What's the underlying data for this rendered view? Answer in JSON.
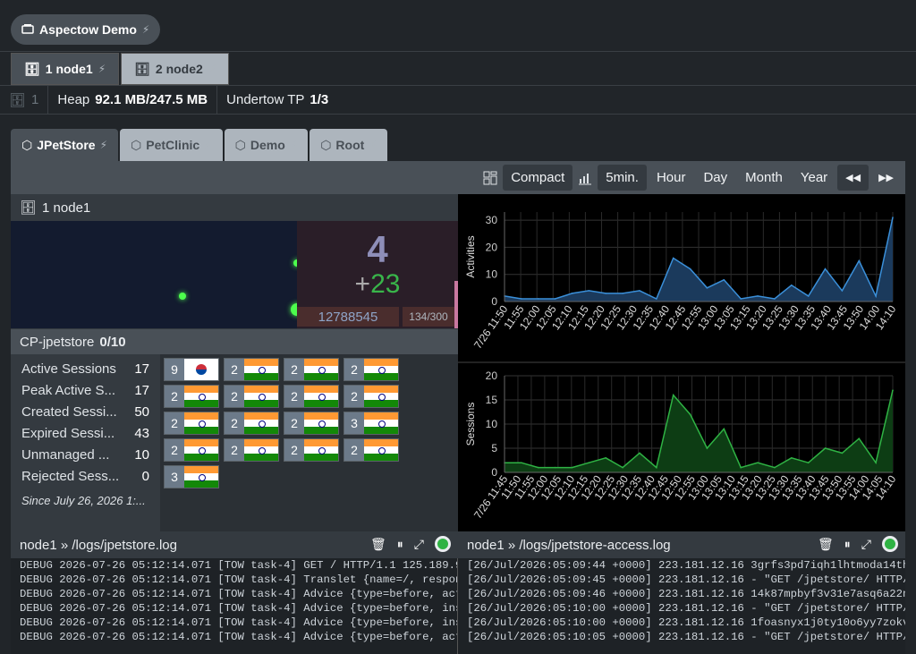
{
  "app": {
    "title": "Aspectow Demo"
  },
  "node_tabs": [
    {
      "label": "1 node1"
    },
    {
      "label": "2 node2"
    }
  ],
  "heap_row": {
    "count": "1",
    "heap_label": "Heap",
    "heap_value": "92.1 MB/247.5 MB",
    "tp_label": "Undertow TP",
    "tp_value": "1/3"
  },
  "app_tabs": [
    {
      "label": "JPetStore"
    },
    {
      "label": "PetClinic"
    },
    {
      "label": "Demo"
    },
    {
      "label": "Root"
    }
  ],
  "toolbar": {
    "compact": "Compact",
    "ranges": [
      "5min.",
      "Hour",
      "Day",
      "Month",
      "Year"
    ],
    "active_range": "5min.",
    "prev": "◀◀",
    "next": "▶▶"
  },
  "node_section": {
    "title": "1 node1",
    "big_count": "4",
    "delta_sign": "+",
    "delta": "23",
    "total": "12788545",
    "ratio": "134/300"
  },
  "cp": {
    "name": "CP-jpetstore",
    "value": "0/10"
  },
  "stats": [
    {
      "label": "Active Sessions",
      "value": "17"
    },
    {
      "label": "Peak Active S...",
      "value": "17"
    },
    {
      "label": "Created Sessi...",
      "value": "50"
    },
    {
      "label": "Expired Sessi...",
      "value": "43"
    },
    {
      "label": "Unmanaged ...",
      "value": "10"
    },
    {
      "label": "Rejected Sess...",
      "value": "0"
    }
  ],
  "since": "Since July 26, 2026 1:...",
  "flags": [
    {
      "count": "9",
      "country": "kr"
    },
    {
      "count": "2",
      "country": "in"
    },
    {
      "count": "2",
      "country": "in"
    },
    {
      "count": "2",
      "country": "in"
    },
    {
      "count": "2",
      "country": "in"
    },
    {
      "count": "2",
      "country": "in"
    },
    {
      "count": "2",
      "country": "in"
    },
    {
      "count": "2",
      "country": "in"
    },
    {
      "count": "2",
      "country": "in"
    },
    {
      "count": "2",
      "country": "in"
    },
    {
      "count": "2",
      "country": "in"
    },
    {
      "count": "3",
      "country": "in"
    },
    {
      "count": "2",
      "country": "in"
    },
    {
      "count": "2",
      "country": "in"
    },
    {
      "count": "2",
      "country": "in"
    },
    {
      "count": "2",
      "country": "in"
    },
    {
      "count": "3",
      "country": "in"
    }
  ],
  "chart_data": [
    {
      "type": "area",
      "ylabel": "Activities",
      "ylim": [
        0,
        33
      ],
      "yticks": [
        0,
        10,
        20,
        30
      ],
      "x": [
        "7/26 11:50",
        "11:55",
        "12:00",
        "12:05",
        "12:10",
        "12:15",
        "12:20",
        "12:25",
        "12:30",
        "12:35",
        "12:40",
        "12:45",
        "12:50",
        "12:55",
        "13:00",
        "13:05",
        "13:10",
        "13:15",
        "13:20",
        "13:25",
        "13:30",
        "13:35",
        "13:40",
        "13:45",
        "13:50",
        "13:55",
        "14:00",
        "14:05",
        "14:10"
      ],
      "xticks": [
        "7/26 11:50",
        "11:55",
        "12:00",
        "12:05",
        "12:10",
        "12:15",
        "12:20",
        "12:25",
        "12:30",
        "12:35",
        "12:40",
        "12:45",
        "12:55",
        "13:00",
        "13:05",
        "13:15",
        "13:20",
        "13:25",
        "13:30",
        "13:35",
        "13:40",
        "13:45",
        "13:50",
        "14:00",
        "14:10"
      ],
      "values": [
        2,
        1,
        1,
        1,
        3,
        4,
        3,
        3,
        4,
        1,
        16,
        12,
        5,
        8,
        1,
        2,
        1,
        6,
        2,
        12,
        4,
        15,
        2,
        31
      ],
      "color": "#3a8fd9",
      "fill": "#1b3a5c"
    },
    {
      "type": "area",
      "ylabel": "Sessions",
      "ylim": [
        0,
        20
      ],
      "yticks": [
        0,
        5,
        10,
        15,
        20
      ],
      "xticks": [
        "7/26 11:45",
        "11:50",
        "11:55",
        "12:00",
        "12:05",
        "12:10",
        "12:15",
        "12:20",
        "12:25",
        "12:30",
        "12:35",
        "12:40",
        "12:45",
        "12:50",
        "12:55",
        "13:00",
        "13:05",
        "13:10",
        "13:15",
        "13:20",
        "13:25",
        "13:30",
        "13:35",
        "13:40",
        "13:45",
        "13:50",
        "13:55",
        "14:00",
        "14:05",
        "14:10"
      ],
      "values": [
        2,
        2,
        1,
        1,
        1,
        2,
        3,
        1,
        4,
        1,
        16,
        12,
        5,
        9,
        1,
        2,
        1,
        3,
        2,
        5,
        4,
        7,
        2,
        17
      ],
      "color": "#2fb344",
      "fill": "#0d3d14"
    }
  ],
  "logs": [
    {
      "title": "node1 » /logs/jpetstore.log",
      "lines": [
        "DEBUG 2026-07-26 05:12:14.071 [TOW task-4] GET / HTTP/1.1 125.189.95",
        "DEBUG 2026-07-26 05:12:14.071 [TOW task-4] Translet {name=/, respons",
        "DEBUG 2026-07-26 05:12:14.071 [TOW task-4] Advice {type=before, acti",
        "DEBUG 2026-07-26 05:12:14.071 [TOW task-4] Advice {type=before, inst",
        "DEBUG 2026-07-26 05:12:14.071 [TOW task-4] Advice {type=before, inst",
        "DEBUG 2026-07-26 05:12:14.071 [TOW task-4] Advice {type=before, acti"
      ]
    },
    {
      "title": "node1 » /logs/jpetstore-access.log",
      "lines": [
        "[26/Jul/2026:05:09:44 +0000] 223.181.12.16 3grfs3pd7iqh1lhtmoda14th4",
        "[26/Jul/2026:05:09:45 +0000] 223.181.12.16 - \"GET /jpetstore/ HTTP/1",
        "[26/Jul/2026:05:09:46 +0000] 223.181.12.16 14k87mpbyf3v31e7asq6a22nc",
        "[26/Jul/2026:05:10:00 +0000] 223.181.12.16 - \"GET /jpetstore/ HTTP/1",
        "[26/Jul/2026:05:10:00 +0000] 223.181.12.16 1foasnyx1j0ty10o6yy7zokvs",
        "[26/Jul/2026:05:10:05 +0000] 223.181.12.16 - \"GET /jpetstore/ HTTP/1"
      ]
    }
  ]
}
